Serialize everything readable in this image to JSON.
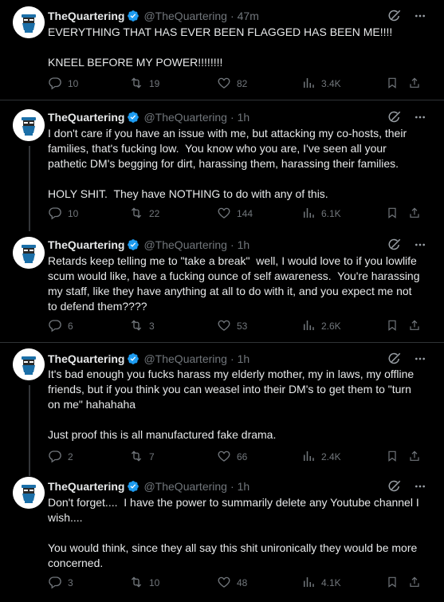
{
  "user": {
    "name": "TheQuartering",
    "handle": "@TheQuartering",
    "dot": "·"
  },
  "tweets": [
    {
      "time": "47m",
      "text": "EVERYTHING THAT HAS EVER BEEN FLAGGED HAS BEEN ME!!!!\n\nKNEEL BEFORE MY POWER!!!!!!!!",
      "replies": "10",
      "retweets": "19",
      "likes": "82",
      "views": "3.4K"
    },
    {
      "time": "1h",
      "text": "I don't care if you have an issue with me, but attacking my co-hosts, their families, that's fucking low.  You know who you are, I've seen all your pathetic DM's begging for dirt, harassing them, harassing their families.\n\nHOLY SHIT.  They have NOTHING to do with any of this.",
      "replies": "10",
      "retweets": "22",
      "likes": "144",
      "views": "6.1K"
    },
    {
      "time": "1h",
      "text": "Retards keep telling me to \"take a break\"  well, I would love to if you lowlife scum would like, have a fucking ounce of self awareness.  You're harassing my staff, like they have anything at all to do with it, and you expect me not to defend them????",
      "replies": "6",
      "retweets": "3",
      "likes": "53",
      "views": "2.6K"
    },
    {
      "time": "1h",
      "text": "It's bad enough you fucks harass my elderly mother, my in laws, my offline friends, but if you think you can weasel into their DM's to get them to \"turn on me\" hahahaha\n\nJust proof this is all manufactured fake drama.",
      "replies": "2",
      "retweets": "7",
      "likes": "66",
      "views": "2.4K"
    },
    {
      "time": "1h",
      "text": "Don't forget....  I have the power to summarily delete any Youtube channel I wish....\n\nYou would think, since they all say this shit unironically they would be more concerned.",
      "replies": "3",
      "retweets": "10",
      "likes": "48",
      "views": "4.1K"
    }
  ],
  "colors": {
    "background": "#000000",
    "text": "#e7e9ea",
    "muted": "#71767b",
    "verified": "#1d9bf0",
    "border": "#2f3336"
  },
  "icons": [
    "verified-badge-icon",
    "grok-icon",
    "more-icon",
    "reply-icon",
    "retweet-icon",
    "like-icon",
    "views-icon",
    "bookmark-icon",
    "share-icon"
  ]
}
